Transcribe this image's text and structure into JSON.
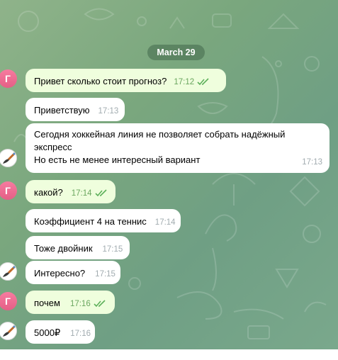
{
  "date_separator": "March 29",
  "messages": [
    {
      "text": "Привет сколько стоит прогноз?",
      "time": "17:12",
      "status": "read"
    },
    {
      "text": "Приветствую",
      "time": "17:13"
    },
    {
      "lines": [
        "Сегодня хоккейная линия не позволяет собрать надёжный",
        "экспресс",
        "Но есть не менее интересный вариант"
      ],
      "time": "17:13"
    },
    {
      "text": "какой?",
      "time": "17:14",
      "status": "read"
    },
    {
      "text": "Коэффициент 4 на теннис",
      "time": "17:14"
    },
    {
      "text": "Тоже двойник",
      "time": "17:15"
    },
    {
      "text": "Интересно?",
      "time": "17:15"
    },
    {
      "text": "почем",
      "time": "17:16",
      "status": "read"
    },
    {
      "text": "5000₽",
      "time": "17:16"
    }
  ],
  "avatars": {
    "user_letter": "Г",
    "user_color": "#ea6b91",
    "contact_icon": "brush-icon"
  },
  "colors": {
    "incoming_bubble": "#ffffff",
    "outgoing_bubble": "#effedd",
    "check_color": "#5db05a",
    "date_pill": "#4f7a57"
  }
}
